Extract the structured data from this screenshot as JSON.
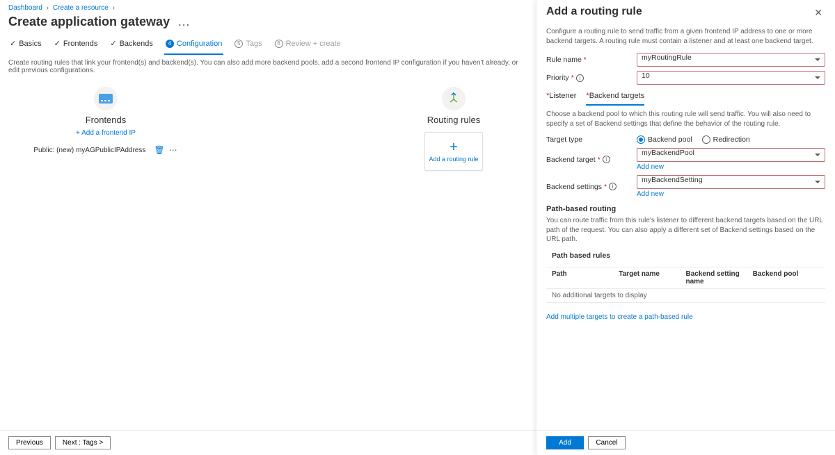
{
  "breadcrumb": {
    "dashboard": "Dashboard",
    "create_resource": "Create a resource"
  },
  "page_title": "Create application gateway",
  "steps": [
    {
      "label": "Basics",
      "state": "done"
    },
    {
      "label": "Frontends",
      "state": "done"
    },
    {
      "label": "Backends",
      "state": "done"
    },
    {
      "label": "Configuration",
      "state": "active",
      "num": "4"
    },
    {
      "label": "Tags",
      "state": "disabled",
      "num": "5"
    },
    {
      "label": "Review + create",
      "state": "disabled",
      "num": "6"
    }
  ],
  "config_note": "Create routing rules that link your frontend(s) and backend(s). You can also add more backend pools, add a second frontend IP configuration if you haven't already, or edit previous configurations.",
  "frontends": {
    "title": "Frontends",
    "add_link": "+ Add a frontend IP",
    "item_label": "Public: (new) myAGPublicIPAddress"
  },
  "routing": {
    "title": "Routing rules",
    "add_label": "Add a routing rule"
  },
  "footer": {
    "prev": "Previous",
    "next": "Next : Tags >"
  },
  "panel": {
    "title": "Add a routing rule",
    "desc": "Configure a routing rule to send traffic from a given frontend IP address to one or more backend targets. A routing rule must contain a listener and at least one backend target.",
    "rule_name_label": "Rule name",
    "rule_name_value": "myRoutingRule",
    "priority_label": "Priority",
    "priority_value": "10",
    "tab_listener": "Listener",
    "tab_backend": "Backend targets",
    "backend_desc": "Choose a backend pool to which this routing rule will send traffic. You will also need to specify a set of Backend settings that define the behavior of the routing rule.",
    "target_type_label": "Target type",
    "target_type_pool": "Backend pool",
    "target_type_redirect": "Redirection",
    "backend_target_label": "Backend target",
    "backend_target_value": "myBackendPool",
    "add_new": "Add new",
    "backend_settings_label": "Backend settings",
    "backend_settings_value": "myBackendSetting",
    "path_head": "Path-based routing",
    "path_desc": "You can route traffic from this rule's listener to different backend targets based on the URL path of the request. You can also apply a different set of Backend settings based on the URL path.",
    "table_section": "Path based rules",
    "th_path": "Path",
    "th_target": "Target name",
    "th_setting": "Backend setting name",
    "th_pool": "Backend pool",
    "empty_row": "No additional targets to display",
    "add_multi": "Add multiple targets to create a path-based rule",
    "btn_add": "Add",
    "btn_cancel": "Cancel"
  }
}
